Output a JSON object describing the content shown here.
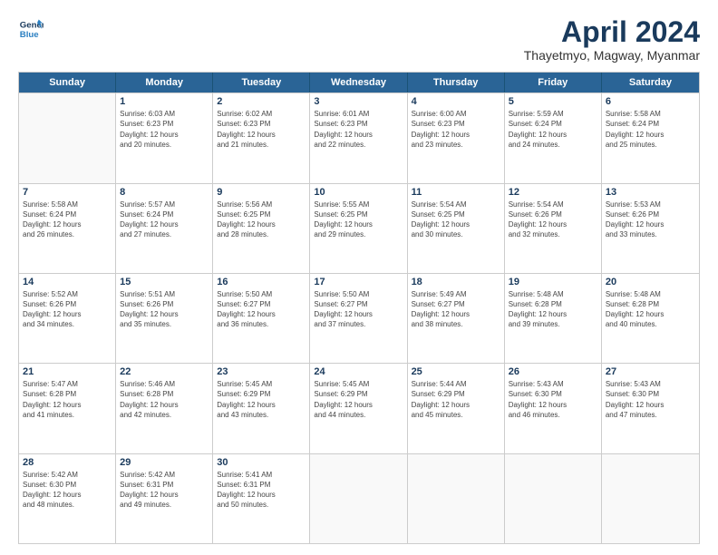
{
  "header": {
    "logo_line1": "General",
    "logo_line2": "Blue",
    "month": "April 2024",
    "location": "Thayetmyo, Magway, Myanmar"
  },
  "weekdays": [
    "Sunday",
    "Monday",
    "Tuesday",
    "Wednesday",
    "Thursday",
    "Friday",
    "Saturday"
  ],
  "rows": [
    [
      {
        "day": "",
        "info": ""
      },
      {
        "day": "1",
        "info": "Sunrise: 6:03 AM\nSunset: 6:23 PM\nDaylight: 12 hours\nand 20 minutes."
      },
      {
        "day": "2",
        "info": "Sunrise: 6:02 AM\nSunset: 6:23 PM\nDaylight: 12 hours\nand 21 minutes."
      },
      {
        "day": "3",
        "info": "Sunrise: 6:01 AM\nSunset: 6:23 PM\nDaylight: 12 hours\nand 22 minutes."
      },
      {
        "day": "4",
        "info": "Sunrise: 6:00 AM\nSunset: 6:23 PM\nDaylight: 12 hours\nand 23 minutes."
      },
      {
        "day": "5",
        "info": "Sunrise: 5:59 AM\nSunset: 6:24 PM\nDaylight: 12 hours\nand 24 minutes."
      },
      {
        "day": "6",
        "info": "Sunrise: 5:58 AM\nSunset: 6:24 PM\nDaylight: 12 hours\nand 25 minutes."
      }
    ],
    [
      {
        "day": "7",
        "info": "Sunrise: 5:58 AM\nSunset: 6:24 PM\nDaylight: 12 hours\nand 26 minutes."
      },
      {
        "day": "8",
        "info": "Sunrise: 5:57 AM\nSunset: 6:24 PM\nDaylight: 12 hours\nand 27 minutes."
      },
      {
        "day": "9",
        "info": "Sunrise: 5:56 AM\nSunset: 6:25 PM\nDaylight: 12 hours\nand 28 minutes."
      },
      {
        "day": "10",
        "info": "Sunrise: 5:55 AM\nSunset: 6:25 PM\nDaylight: 12 hours\nand 29 minutes."
      },
      {
        "day": "11",
        "info": "Sunrise: 5:54 AM\nSunset: 6:25 PM\nDaylight: 12 hours\nand 30 minutes."
      },
      {
        "day": "12",
        "info": "Sunrise: 5:54 AM\nSunset: 6:26 PM\nDaylight: 12 hours\nand 32 minutes."
      },
      {
        "day": "13",
        "info": "Sunrise: 5:53 AM\nSunset: 6:26 PM\nDaylight: 12 hours\nand 33 minutes."
      }
    ],
    [
      {
        "day": "14",
        "info": "Sunrise: 5:52 AM\nSunset: 6:26 PM\nDaylight: 12 hours\nand 34 minutes."
      },
      {
        "day": "15",
        "info": "Sunrise: 5:51 AM\nSunset: 6:26 PM\nDaylight: 12 hours\nand 35 minutes."
      },
      {
        "day": "16",
        "info": "Sunrise: 5:50 AM\nSunset: 6:27 PM\nDaylight: 12 hours\nand 36 minutes."
      },
      {
        "day": "17",
        "info": "Sunrise: 5:50 AM\nSunset: 6:27 PM\nDaylight: 12 hours\nand 37 minutes."
      },
      {
        "day": "18",
        "info": "Sunrise: 5:49 AM\nSunset: 6:27 PM\nDaylight: 12 hours\nand 38 minutes."
      },
      {
        "day": "19",
        "info": "Sunrise: 5:48 AM\nSunset: 6:28 PM\nDaylight: 12 hours\nand 39 minutes."
      },
      {
        "day": "20",
        "info": "Sunrise: 5:48 AM\nSunset: 6:28 PM\nDaylight: 12 hours\nand 40 minutes."
      }
    ],
    [
      {
        "day": "21",
        "info": "Sunrise: 5:47 AM\nSunset: 6:28 PM\nDaylight: 12 hours\nand 41 minutes."
      },
      {
        "day": "22",
        "info": "Sunrise: 5:46 AM\nSunset: 6:28 PM\nDaylight: 12 hours\nand 42 minutes."
      },
      {
        "day": "23",
        "info": "Sunrise: 5:45 AM\nSunset: 6:29 PM\nDaylight: 12 hours\nand 43 minutes."
      },
      {
        "day": "24",
        "info": "Sunrise: 5:45 AM\nSunset: 6:29 PM\nDaylight: 12 hours\nand 44 minutes."
      },
      {
        "day": "25",
        "info": "Sunrise: 5:44 AM\nSunset: 6:29 PM\nDaylight: 12 hours\nand 45 minutes."
      },
      {
        "day": "26",
        "info": "Sunrise: 5:43 AM\nSunset: 6:30 PM\nDaylight: 12 hours\nand 46 minutes."
      },
      {
        "day": "27",
        "info": "Sunrise: 5:43 AM\nSunset: 6:30 PM\nDaylight: 12 hours\nand 47 minutes."
      }
    ],
    [
      {
        "day": "28",
        "info": "Sunrise: 5:42 AM\nSunset: 6:30 PM\nDaylight: 12 hours\nand 48 minutes."
      },
      {
        "day": "29",
        "info": "Sunrise: 5:42 AM\nSunset: 6:31 PM\nDaylight: 12 hours\nand 49 minutes."
      },
      {
        "day": "30",
        "info": "Sunrise: 5:41 AM\nSunset: 6:31 PM\nDaylight: 12 hours\nand 50 minutes."
      },
      {
        "day": "",
        "info": ""
      },
      {
        "day": "",
        "info": ""
      },
      {
        "day": "",
        "info": ""
      },
      {
        "day": "",
        "info": ""
      }
    ]
  ]
}
